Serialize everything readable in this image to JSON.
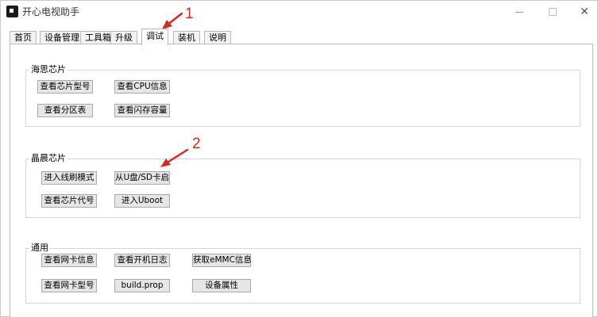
{
  "window": {
    "title": "开心电视助手",
    "close_glyph": "✕"
  },
  "tabs": [
    "首页",
    "设备管理",
    "工具箱",
    "升级",
    "调试",
    "装机",
    "说明"
  ],
  "active_tab": "调试",
  "groups": [
    {
      "title": "海思芯片",
      "buttons": [
        "查看芯片型号",
        "查看CPU信息",
        "查看分区表",
        "查看闪存容量"
      ]
    },
    {
      "title": "晶晨芯片",
      "buttons": [
        "进入线刷模式",
        "从U盘/SD卡启",
        "查看芯片代号",
        "进入Uboot"
      ]
    },
    {
      "title": "通用",
      "buttons": [
        "查看网卡信息",
        "查看开机日志",
        "获取eMMC信息",
        "查看网卡型号",
        "build.prop",
        "设备属性"
      ]
    }
  ],
  "annotations": {
    "marker1": "1",
    "marker2": "2",
    "color": "#d42a24"
  }
}
